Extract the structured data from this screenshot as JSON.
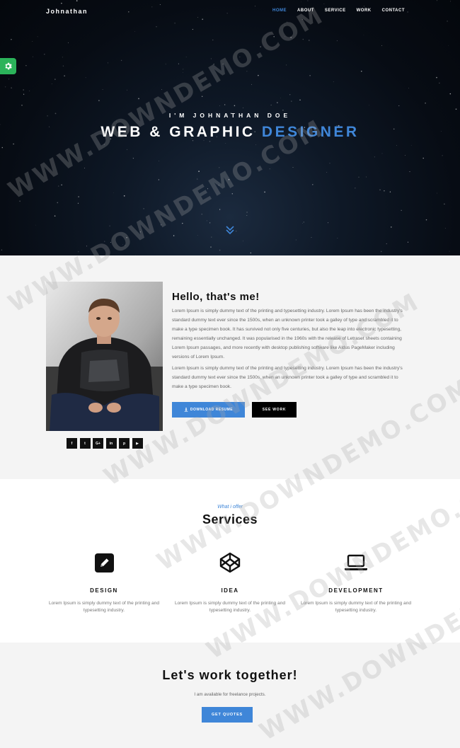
{
  "nav": {
    "brand": "Johnathan",
    "items": [
      {
        "label": "HOME",
        "active": true
      },
      {
        "label": "ABOUT",
        "active": false
      },
      {
        "label": "SERVICE",
        "active": false
      },
      {
        "label": "WORK",
        "active": false
      },
      {
        "label": "CONTACT",
        "active": false
      }
    ]
  },
  "settings": {
    "icon": "gear-icon"
  },
  "hero": {
    "subtitle": "I'M JOHNATHAN DOE",
    "title_main": "WEB & GRAPHIC ",
    "title_highlight": "DESIGNER",
    "scroll_icon": "double-chevron-down-icon"
  },
  "about": {
    "title": "Hello, that's me!",
    "paragraph1": "Lorem Ipsum is simply dummy text of the printing and typesetting industry. Lorem Ipsum has been the industry's standard dummy text ever since the 1500s, when an unknown printer took a galley of type and scrambled it to make a type specimen book. It has survived not only five centuries, but also the leap into electronic typesetting, remaining essentially unchanged. It was popularised in the 1960s with the release of Letraset sheets containing Lorem Ipsum passages, and more recently with desktop publishing software like Aldus PageMaker including versions of Lorem Ipsum.",
    "paragraph2": "Lorem Ipsum is simply dummy text of the printing and typesetting industry. Lorem Ipsum has been the industry's standard dummy text ever since the 1500s, when an unknown printer took a galley of type and scrambled it to make a type specimen book.",
    "download_label": "DOWNLOAD RESUME",
    "work_label": "SEE WORK",
    "socials": [
      {
        "glyph": "f",
        "icon": "facebook-icon"
      },
      {
        "glyph": "t",
        "icon": "twitter-icon"
      },
      {
        "glyph": "G+",
        "icon": "google-plus-icon"
      },
      {
        "glyph": "in",
        "icon": "linkedin-icon"
      },
      {
        "glyph": "p",
        "icon": "pinterest-icon"
      },
      {
        "glyph": "▶",
        "icon": "youtube-icon"
      }
    ]
  },
  "services": {
    "eyebrow": "What i offer",
    "title": "Services",
    "items": [
      {
        "name": "DESIGN",
        "desc": "Lorem Ipsum is simply dummy text of the printing and typesetting industry.",
        "icon": "pencil-square-icon"
      },
      {
        "name": "IDEA",
        "desc": "Lorem Ipsum is simply dummy text of the printing and typesetting industry.",
        "icon": "codepen-cube-icon"
      },
      {
        "name": "DEVELOPMENT",
        "desc": "Lorem Ipsum is simply dummy text of the printing and typesetting industry.",
        "icon": "laptop-icon"
      }
    ]
  },
  "cta": {
    "title": "Let's work together!",
    "subtitle": "I am available for freelance projects.",
    "button": "GET QUOTES"
  },
  "watermark": "WWW.DOWNDEMO.COM",
  "colors": {
    "accent": "#3f86d8",
    "settings": "#2bb35a"
  }
}
